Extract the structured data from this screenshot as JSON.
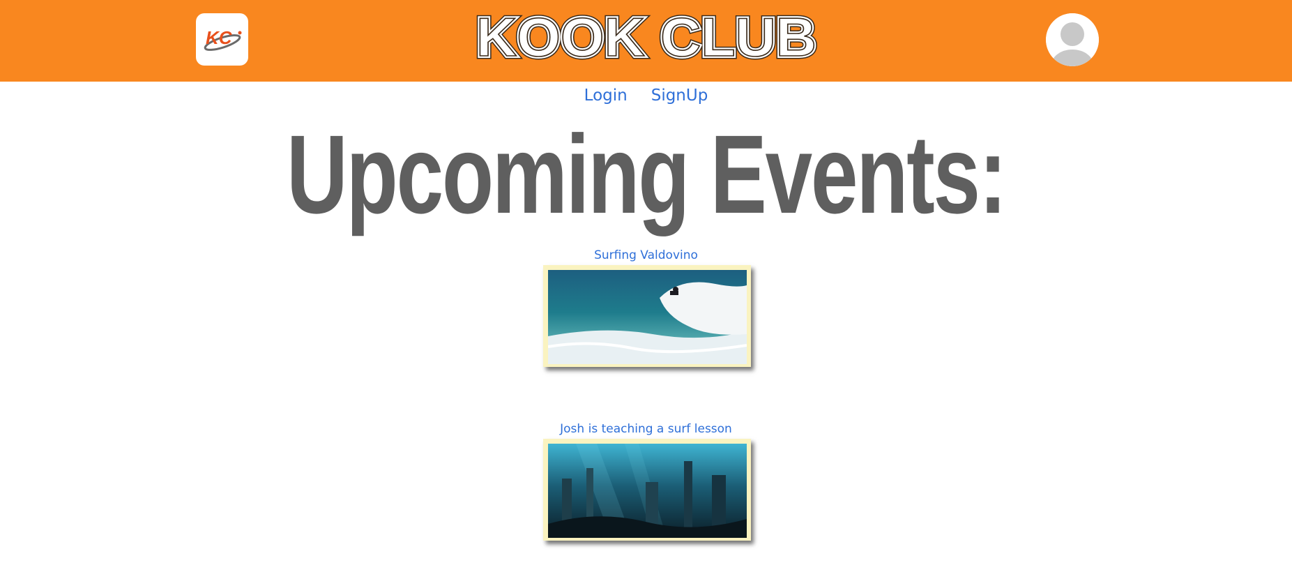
{
  "header": {
    "brand": "KOOK CLUB",
    "logo_text": "KC",
    "logo_icon": "kc-logo-icon",
    "avatar_icon": "user-avatar-icon"
  },
  "nav": {
    "login_label": "Login",
    "signup_label": "SignUp"
  },
  "main": {
    "heading": "Upcoming Events:",
    "events": [
      {
        "title": "Surfing Valdovino",
        "image_icon": "surfer-wave-photo"
      },
      {
        "title": "Josh is teaching a surf lesson",
        "image_icon": "underwater-city-photo"
      }
    ]
  },
  "colors": {
    "header_bg": "#f9871f",
    "link": "#2e6fd8",
    "heading": "#5f5f5f",
    "frame": "#faf3c0"
  }
}
